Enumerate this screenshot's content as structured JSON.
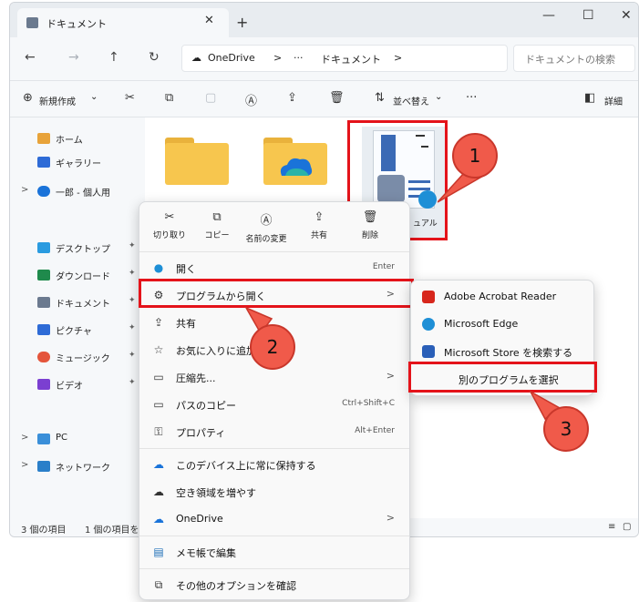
{
  "window": {
    "tab_title": "ドキュメント",
    "tab_close": "✕",
    "new_tab": "+",
    "minimize": "—",
    "maximize": "☐",
    "close": "✕"
  },
  "address": {
    "back": "←",
    "forward": "→",
    "up": "↑",
    "refresh": "↻",
    "breadcrumb_root": "OneDrive",
    "breadcrumb_sep1": ">",
    "breadcrumb_more": "···",
    "breadcrumb_folder": "ドキュメント",
    "breadcrumb_sep2": ">",
    "search_placeholder": "ドキュメントの検索"
  },
  "toolbar": {
    "new_label": "新規作成",
    "new_caret": "⌄",
    "sort_label": "並べ替え",
    "sort_caret": "⌄",
    "more": "···",
    "details_label": "詳細"
  },
  "sidebar": {
    "items": [
      {
        "label": "ホーム",
        "color": "#e8a33a"
      },
      {
        "label": "ギャラリー",
        "color": "#2e6bd6"
      },
      {
        "label": "一郎 - 個人用",
        "color": "#1a73d9"
      },
      {
        "label": "デスクトップ",
        "color": "#2a9be0"
      },
      {
        "label": "ダウンロード",
        "color": "#1f8a4c"
      },
      {
        "label": "ドキュメント",
        "color": "#6b7a8f"
      },
      {
        "label": "ピクチャ",
        "color": "#2e6bd6"
      },
      {
        "label": "ミュージック",
        "color": "#e4553b"
      },
      {
        "label": "ビデオ",
        "color": "#7b3fd1"
      },
      {
        "label": "PC",
        "color": "#3a8fd9"
      },
      {
        "label": "ネットワーク",
        "color": "#2a7fc9"
      }
    ],
    "caret": ">",
    "pin": "📌"
  },
  "main": {
    "file_label_fragment": "ュアル"
  },
  "status": {
    "item_count": "3 個の項目",
    "selected": "1 個の項目を"
  },
  "context_menu": {
    "quick_actions": [
      {
        "label": "切り取り",
        "icon": "✂"
      },
      {
        "label": "コピー",
        "icon": "⧉"
      },
      {
        "label": "名前の変更",
        "icon": "Ⓐ"
      },
      {
        "label": "共有",
        "icon": "⇪"
      },
      {
        "label": "削除",
        "icon": "🗑"
      }
    ],
    "items": [
      {
        "label": "開く",
        "accel": "Enter",
        "icon": "●"
      },
      {
        "label": "プログラムから開く",
        "accel": ">",
        "icon": "⚙"
      },
      {
        "label": "共有",
        "accel": "",
        "icon": "⇪"
      },
      {
        "label": "お気に入りに追加",
        "accel": "",
        "icon": "☆"
      },
      {
        "label": "圧縮先...",
        "accel": ">",
        "icon": "▭"
      },
      {
        "label": "パスのコピー",
        "accel": "Ctrl+Shift+C",
        "icon": "▭"
      },
      {
        "label": "プロパティ",
        "accel": "Alt+Enter",
        "icon": "⚿"
      },
      {
        "label": "このデバイス上に常に保持する",
        "accel": "",
        "icon": "☁"
      },
      {
        "label": "空き領域を増やす",
        "accel": "",
        "icon": "☁"
      },
      {
        "label": "OneDrive",
        "accel": ">",
        "icon": "☁"
      },
      {
        "label": "メモ帳で編集",
        "accel": "",
        "icon": "▤"
      },
      {
        "label": "その他のオプションを確認",
        "accel": "",
        "icon": "⧉"
      }
    ]
  },
  "submenu": {
    "items": [
      {
        "label": "Adobe Acrobat Reader",
        "color": "#d7261c"
      },
      {
        "label": "Microsoft Edge",
        "color": "#1e8fd6"
      },
      {
        "label": "Microsoft Store を検索する",
        "color": "#2a5fb8"
      },
      {
        "label": "別のプログラムを選択",
        "color": ""
      }
    ]
  },
  "callouts": {
    "one": "1",
    "two": "2",
    "three": "3"
  },
  "colors": {
    "highlight": "#e4131a",
    "callout": "#f05a4a"
  }
}
